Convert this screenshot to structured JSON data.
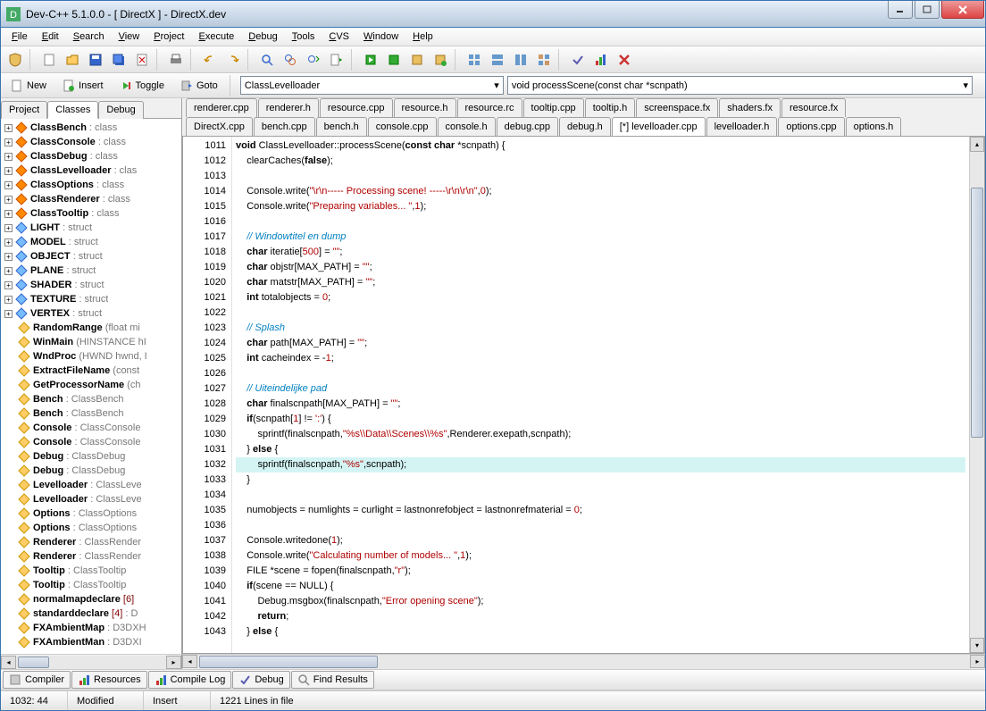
{
  "title": "Dev-C++ 5.1.0.0 - [ DirectX ] - DirectX.dev",
  "menu": [
    "File",
    "Edit",
    "Search",
    "View",
    "Project",
    "Execute",
    "Debug",
    "Tools",
    "CVS",
    "Window",
    "Help"
  ],
  "tb2": {
    "new": "New",
    "insert": "Insert",
    "toggle": "Toggle",
    "goto": "Goto"
  },
  "combo1": "ClassLevelloader",
  "combo2": "void processScene(const char *scnpath)",
  "leftTabs": [
    "Project",
    "Classes",
    "Debug"
  ],
  "activeLeftTab": 1,
  "tree": [
    {
      "exp": "+",
      "icon": "c",
      "label": "ClassBench",
      "sub": "class"
    },
    {
      "exp": "+",
      "icon": "c",
      "label": "ClassConsole",
      "sub": "class"
    },
    {
      "exp": "+",
      "icon": "c",
      "label": "ClassDebug",
      "sub": "class"
    },
    {
      "exp": "+",
      "icon": "c",
      "label": "ClassLevelloader",
      "sub": "clas"
    },
    {
      "exp": "+",
      "icon": "c",
      "label": "ClassOptions",
      "sub": "class"
    },
    {
      "exp": "+",
      "icon": "c",
      "label": "ClassRenderer",
      "sub": "class"
    },
    {
      "exp": "+",
      "icon": "c",
      "label": "ClassTooltip",
      "sub": "class"
    },
    {
      "exp": "+",
      "icon": "s",
      "label": "LIGHT",
      "sub": "struct"
    },
    {
      "exp": "+",
      "icon": "s",
      "label": "MODEL",
      "sub": "struct"
    },
    {
      "exp": "+",
      "icon": "s",
      "label": "OBJECT",
      "sub": "struct"
    },
    {
      "exp": "+",
      "icon": "s",
      "label": "PLANE",
      "sub": "struct"
    },
    {
      "exp": "+",
      "icon": "s",
      "label": "SHADER",
      "sub": "struct"
    },
    {
      "exp": "+",
      "icon": "s",
      "label": "TEXTURE",
      "sub": "struct"
    },
    {
      "exp": "+",
      "icon": "s",
      "label": "VERTEX",
      "sub": "struct"
    },
    {
      "exp": "",
      "icon": "f",
      "label": "RandomRange",
      "param": "(float mi"
    },
    {
      "exp": "",
      "icon": "f",
      "label": "WinMain",
      "param": "(HINSTANCE hI"
    },
    {
      "exp": "",
      "icon": "f",
      "label": "WndProc",
      "param": "(HWND hwnd, I"
    },
    {
      "exp": "",
      "icon": "f",
      "label": "ExtractFileName",
      "param": "(const"
    },
    {
      "exp": "",
      "icon": "f",
      "label": "GetProcessorName",
      "param": "(ch"
    },
    {
      "exp": "",
      "icon": "v",
      "label": "Bench",
      "sub": "ClassBench"
    },
    {
      "exp": "",
      "icon": "v",
      "label": "Bench",
      "sub": "ClassBench"
    },
    {
      "exp": "",
      "icon": "v",
      "label": "Console",
      "sub": "ClassConsole"
    },
    {
      "exp": "",
      "icon": "v",
      "label": "Console",
      "sub": "ClassConsole"
    },
    {
      "exp": "",
      "icon": "v",
      "label": "Debug",
      "sub": "ClassDebug"
    },
    {
      "exp": "",
      "icon": "v",
      "label": "Debug",
      "sub": "ClassDebug"
    },
    {
      "exp": "",
      "icon": "v",
      "label": "Levelloader",
      "sub": "ClassLeve"
    },
    {
      "exp": "",
      "icon": "v",
      "label": "Levelloader",
      "sub": "ClassLeve"
    },
    {
      "exp": "",
      "icon": "v",
      "label": "Options",
      "sub": "ClassOptions"
    },
    {
      "exp": "",
      "icon": "v",
      "label": "Options",
      "sub": "ClassOptions"
    },
    {
      "exp": "",
      "icon": "v",
      "label": "Renderer",
      "sub": "ClassRender"
    },
    {
      "exp": "",
      "icon": "v",
      "label": "Renderer",
      "sub": "ClassRender"
    },
    {
      "exp": "",
      "icon": "v",
      "label": "Tooltip",
      "sub": "ClassTooltip"
    },
    {
      "exp": "",
      "icon": "v",
      "label": "Tooltip",
      "sub": "ClassTooltip"
    },
    {
      "exp": "",
      "icon": "v",
      "label": "normalmapdeclare",
      "red": "[6]"
    },
    {
      "exp": "",
      "icon": "v",
      "label": "standarddeclare",
      "red": "[4]",
      "sub": "D"
    },
    {
      "exp": "",
      "icon": "v",
      "label": "FXAmbientMap",
      "sub": "D3DXH"
    },
    {
      "exp": "",
      "icon": "v",
      "label": "FXAmbientMan",
      "sub": "D3DXI"
    }
  ],
  "fileTabs1": [
    "renderer.cpp",
    "renderer.h",
    "resource.cpp",
    "resource.h",
    "resource.rc",
    "tooltip.cpp",
    "tooltip.h",
    "screenspace.fx",
    "shaders.fx",
    "resource.fx"
  ],
  "fileTabs2": [
    "DirectX.cpp",
    "bench.cpp",
    "bench.h",
    "console.cpp",
    "console.h",
    "debug.cpp",
    "debug.h",
    "[*] levelloader.cpp",
    "levelloader.h",
    "options.cpp",
    "options.h"
  ],
  "activeFileTab": 7,
  "lines": [
    {
      "n": 1011,
      "html": "<span class='kw'>void</span> ClassLevelloader::processScene(<span class='kw'>const</span> <span class='kw'>char</span> *scnpath) {"
    },
    {
      "n": 1012,
      "html": "    clearCaches(<span class='kw'>false</span>);"
    },
    {
      "n": 1013,
      "html": ""
    },
    {
      "n": 1014,
      "html": "    Console.write(<span class='str'>\"\\r\\n----- Processing scene! -----\\r\\n\\r\\n\"</span>,<span class='num'>0</span>);"
    },
    {
      "n": 1015,
      "html": "    Console.write(<span class='str'>\"Preparing variables... \"</span>,<span class='num'>1</span>);"
    },
    {
      "n": 1016,
      "html": ""
    },
    {
      "n": 1017,
      "html": "    <span class='cmt'>// Windowtitel en dump</span>"
    },
    {
      "n": 1018,
      "html": "    <span class='kw'>char</span> iteratie[<span class='num'>500</span>] = <span class='str'>\"\"</span>;"
    },
    {
      "n": 1019,
      "html": "    <span class='kw'>char</span> objstr[MAX_PATH] = <span class='str'>\"\"</span>;"
    },
    {
      "n": 1020,
      "html": "    <span class='kw'>char</span> matstr[MAX_PATH] = <span class='str'>\"\"</span>;"
    },
    {
      "n": 1021,
      "html": "    <span class='kw'>int</span> totalobjects = <span class='num'>0</span>;"
    },
    {
      "n": 1022,
      "html": ""
    },
    {
      "n": 1023,
      "html": "    <span class='cmt'>// Splash</span>"
    },
    {
      "n": 1024,
      "html": "    <span class='kw'>char</span> path[MAX_PATH] = <span class='str'>\"\"</span>;"
    },
    {
      "n": 1025,
      "html": "    <span class='kw'>int</span> cacheindex = -<span class='num'>1</span>;"
    },
    {
      "n": 1026,
      "html": ""
    },
    {
      "n": 1027,
      "html": "    <span class='cmt'>// Uiteindelijke pad</span>"
    },
    {
      "n": 1028,
      "html": "    <span class='kw'>char</span> finalscnpath[MAX_PATH] = <span class='str'>\"\"</span>;"
    },
    {
      "n": 1029,
      "html": "    <span class='kw'>if</span>(scnpath[<span class='num'>1</span>] != <span class='str'>':'</span>) {"
    },
    {
      "n": 1030,
      "html": "        sprintf(finalscnpath,<span class='str'>\"%s\\\\Data\\\\Scenes\\\\%s\"</span>,Renderer.exepath,scnpath);"
    },
    {
      "n": 1031,
      "html": "    } <span class='kw'>else</span> {"
    },
    {
      "n": 1032,
      "hl": true,
      "html": "        sprintf(finalscnpath,<span class='str'>\"%s\"</span>,scnpath);"
    },
    {
      "n": 1033,
      "html": "    }"
    },
    {
      "n": 1034,
      "html": ""
    },
    {
      "n": 1035,
      "html": "    numobjects = numlights = curlight = lastnonrefobject = lastnonrefmaterial = <span class='num'>0</span>;"
    },
    {
      "n": 1036,
      "html": ""
    },
    {
      "n": 1037,
      "html": "    Console.writedone(<span class='num'>1</span>);"
    },
    {
      "n": 1038,
      "html": "    Console.write(<span class='str'>\"Calculating number of models... \"</span>,<span class='num'>1</span>);"
    },
    {
      "n": 1039,
      "html": "    FILE *scene = fopen(finalscnpath,<span class='str'>\"r\"</span>);"
    },
    {
      "n": 1040,
      "html": "    <span class='kw'>if</span>(scene == NULL) {"
    },
    {
      "n": 1041,
      "html": "        Debug.msgbox(finalscnpath,<span class='str'>\"Error opening scene\"</span>);"
    },
    {
      "n": 1042,
      "html": "        <span class='kw'>return</span>;"
    },
    {
      "n": 1043,
      "html": "    } <span class='kw'>else</span> {"
    }
  ],
  "bottomTabs": [
    "Compiler",
    "Resources",
    "Compile Log",
    "Debug",
    "Find Results"
  ],
  "status": {
    "pos": "1032: 44",
    "mod": "Modified",
    "ins": "Insert",
    "lines": "1221 Lines in file"
  }
}
